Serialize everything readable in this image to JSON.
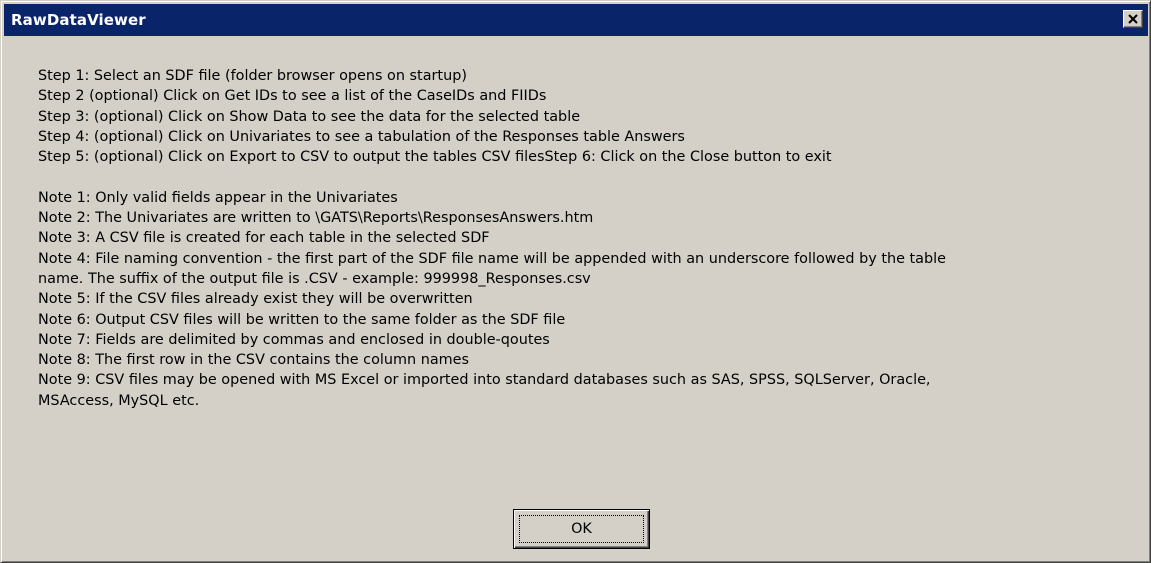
{
  "window": {
    "title": "RawDataViewer"
  },
  "message": {
    "steps": [
      "Step 1: Select an SDF file (folder browser opens on startup)",
      "Step 2 (optional) Click on Get IDs to see a list of the CaseIDs and FIIDs",
      "Step 3: (optional) Click on Show Data to see the data for the selected table",
      "Step 4: (optional) Click on Univariates to see a tabulation of the Responses table Answers",
      "Step 5: (optional) Click on Export to CSV to output the tables CSV filesStep 6: Click on the Close button to exit"
    ],
    "notes": [
      "Note 1: Only valid fields appear in the Univariates",
      "Note 2: The Univariates are written to \\GATS\\Reports\\ResponsesAnswers.htm",
      "Note 3: A CSV file is created for each table in the selected SDF",
      "Note 4: File naming convention - the first part of the SDF file name will be appended with an underscore followed by the table",
      "name.  The suffix of the output file is .CSV - example: 999998_Responses.csv",
      "Note 5: If the CSV files already exist they will be overwritten",
      "Note 6: Output CSV files will be written to the same folder as the SDF file",
      "Note 7: Fields are delimited by commas and enclosed in double-qoutes",
      "Note 8: The first row in the CSV contains the column names",
      "Note 9: CSV files may be opened with MS Excel or imported into standard databases such as SAS, SPSS, SQLServer, Oracle,",
      "MSAccess, MySQL etc."
    ]
  },
  "buttons": {
    "ok_label": "OK",
    "close_icon": "close-x-icon"
  },
  "colors": {
    "titlebar": "#0a246a",
    "dialog_face": "#d4d0c8"
  }
}
